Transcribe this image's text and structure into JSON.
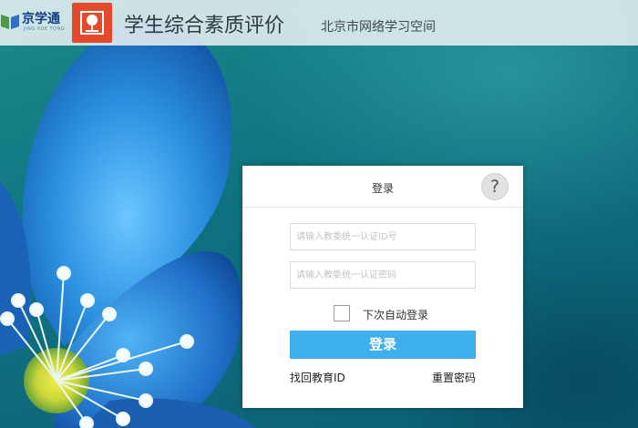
{
  "header": {
    "brand_logo_text": "京学通",
    "brand_logo_subtext": "JING XUE TONG",
    "app_title": "学生综合素质评价",
    "site_name": "北京市网络学习空间"
  },
  "login": {
    "title": "登录",
    "help_label": "?",
    "username_placeholder": "请输入教委统一认证ID号",
    "password_placeholder": "请输入教委统一认证密码",
    "remember_label": "下次自动登录",
    "remember_checked": false,
    "submit_label": "登录",
    "find_id_label": "找回教育ID",
    "reset_password_label": "重置密码"
  },
  "colors": {
    "accent_button": "#3fb0ee",
    "logo_badge": "#e24a2b",
    "brand_blue": "#123f8a"
  },
  "icons": {
    "brand": "book-icon",
    "badge": "tree-icon",
    "help": "help-icon"
  }
}
